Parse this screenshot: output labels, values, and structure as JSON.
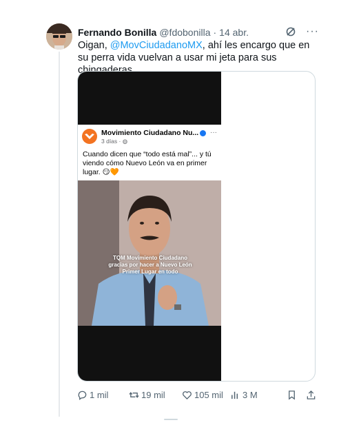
{
  "tweet": {
    "author_name": "Fernando Bonilla",
    "author_handle": "@fdobonilla",
    "separator": "·",
    "timestamp": "14 abr.",
    "text_prefix": "Oigan, ",
    "mention": "@MovCiudadanoMX",
    "text_suffix": ", ahí les encargo que en su perra vida vuelvan a usar mi jeta para sus chingaderas."
  },
  "embedded_post": {
    "page_name": "Movimiento Ciudadano Nu...",
    "post_age": "3 días ·",
    "more": "···",
    "text": "Cuando dicen que “todo está mal”... y tú viendo cómo Nuevo León va en primer lugar. 😏🧡",
    "overlay_text": "TQM Movimiento Ciudadano gracias por hacer a Nuevo León Primer Lugar en todo"
  },
  "actions": {
    "replies": "1 mil",
    "reposts": "19 mil",
    "likes": "105 mil",
    "views": "3 M"
  },
  "icons": {
    "header": [
      "grok-icon",
      "more-icon"
    ],
    "actions": [
      "reply-icon",
      "repost-icon",
      "like-icon",
      "views-icon",
      "bookmark-icon",
      "share-icon"
    ]
  },
  "colors": {
    "accent": "#1d9bf0",
    "text": "#0f1419",
    "muted": "#536471",
    "mc_orange": "#f37321"
  }
}
